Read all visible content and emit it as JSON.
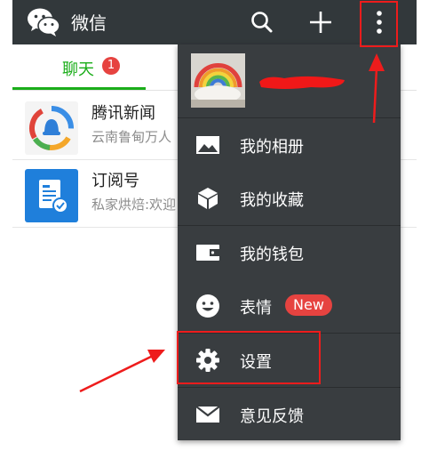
{
  "header": {
    "title": "微信",
    "icons": {
      "logo": "wechat-logo-icon",
      "search": "search-icon",
      "add": "plus-icon",
      "more": "more-vertical-icon"
    }
  },
  "tabs": {
    "chat": {
      "label": "聊天",
      "badge": "1"
    }
  },
  "chats": [
    {
      "name": "腾讯新闻",
      "preview": "云南鲁甸万人",
      "icon": "tencent-news-icon"
    },
    {
      "name": "订阅号",
      "preview": "私家烘焙:欢迎",
      "icon": "subscription-icon"
    }
  ],
  "menu": {
    "items": [
      {
        "label": "我的相册",
        "icon": "album-icon"
      },
      {
        "label": "我的收藏",
        "icon": "favorites-cube-icon"
      },
      {
        "label": "我的钱包",
        "icon": "wallet-icon"
      },
      {
        "label": "表情",
        "icon": "smiley-icon",
        "badge": "New"
      },
      {
        "label": "设置",
        "icon": "gear-icon"
      },
      {
        "label": "意见反馈",
        "icon": "envelope-icon"
      }
    ]
  },
  "colors": {
    "bar": "#32383b",
    "menu": "#393d40",
    "accent_green": "#1aad19",
    "badge_red": "#e64340",
    "annotation_red": "#ee1c1c"
  }
}
